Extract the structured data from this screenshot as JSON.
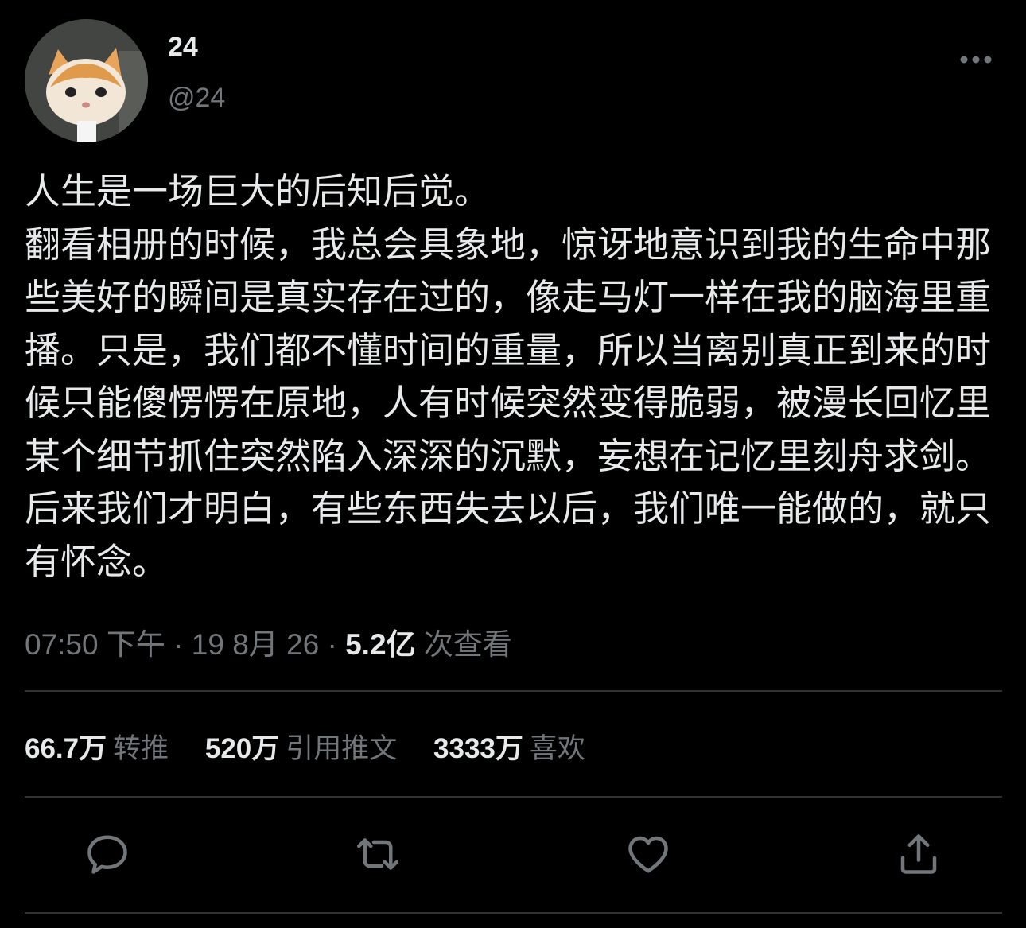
{
  "author": {
    "name": "24",
    "handle": "@24",
    "avatar_icon": "cat-avatar"
  },
  "more_icon": "more-horizontal-icon",
  "tweet": {
    "text": "人生是一场巨大的后知后觉。\n翻看相册的时候，我总会具象地，惊讶地意识到我的生命中那些美好的瞬间是真实存在过的，像走马灯一样在我的脑海里重播。只是，我们都不懂时间的重量，所以当离别真正到来的时候只能傻愣愣在原地，人有时候突然变得脆弱，被漫长回忆里某个细节抓住突然陷入深深的沉默，妄想在记忆里刻舟求剑。后来我们才明白，有些东西失去以后，我们唯一能做的，就只有怀念。"
  },
  "meta": {
    "time": "07:50 下午",
    "sep1": "·",
    "date": "19 8月 26",
    "sep2": "·",
    "views": "5.2亿",
    "views_label": "次查看"
  },
  "stats": {
    "retweets": "66.7万",
    "retweets_label": "转推",
    "quotes": "520万",
    "quotes_label": "引用推文",
    "likes": "3333万",
    "likes_label": "喜欢"
  },
  "actions": {
    "reply_icon": "reply-icon",
    "retweet_icon": "retweet-icon",
    "like_icon": "heart-icon",
    "share_icon": "share-icon"
  },
  "colors": {
    "background": "#000000",
    "text": "#e7e9ea",
    "secondary": "#71767b",
    "divider": "#2f3336"
  }
}
